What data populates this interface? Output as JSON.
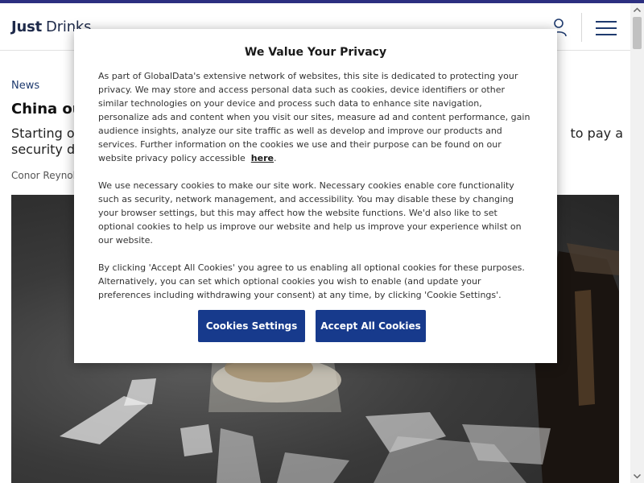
{
  "header": {
    "logo_bold": "Just",
    "logo_light": "Drinks"
  },
  "article": {
    "category": "News",
    "headline": "China ou",
    "standfirst_left": "Starting o",
    "standfirst_left2": "security de",
    "standfirst_right": "to pay a",
    "byline": "Conor Reynol"
  },
  "cookie_modal": {
    "title": "We Value Your Privacy",
    "paragraph1": "As part of GlobalData's extensive network of websites, this site is dedicated to protecting your privacy. We may store and access personal data such as cookies, device identifiers or other similar technologies on your device and process such data to enhance site navigation, personalize ads and content when you visit our sites, measure ad and content performance, gain audience insights, analyze our site traffic as well as develop and improve our products and services. Further information on the cookies we use and their purpose can be found on our website privacy policy accessible",
    "link_text": "here",
    "paragraph2": "We use necessary cookies to make our site work. Necessary cookies enable core functionality such as security, network management, and accessibility. You may disable these by changing your browser settings, but this may affect how the website functions. We'd also like to set optional cookies to help us improve our website and help us improve your experience whilst on our website.",
    "paragraph3": "By clicking 'Accept All Cookies' you agree to us enabling all optional cookies for these purposes. Alternatively, you can set which optional cookies you wish to enable (and update your preferences including withdrawing your consent) at any time, by clicking 'Cookie Settings'.",
    "settings_button": "Cookies Settings",
    "accept_button": "Accept All Cookies"
  },
  "colors": {
    "brand": "#2c2f80",
    "button": "#173a8c"
  }
}
